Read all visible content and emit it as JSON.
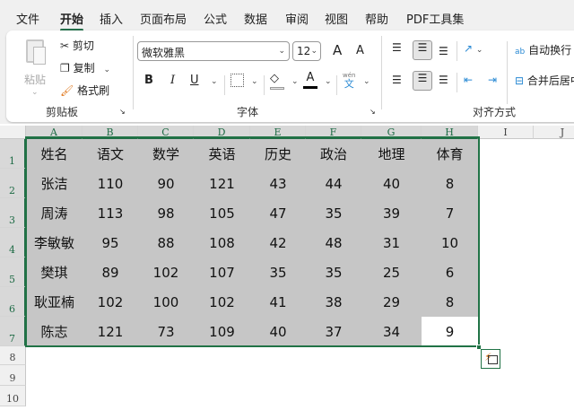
{
  "menu": [
    "文件",
    "开始",
    "插入",
    "页面布局",
    "公式",
    "数据",
    "审阅",
    "视图",
    "帮助",
    "PDF工具集"
  ],
  "menu_active": 1,
  "ribbon": {
    "clipboard": {
      "paste": "粘贴",
      "cut": "剪切",
      "copy": "复制",
      "format_painter": "格式刷",
      "group": "剪贴板"
    },
    "font": {
      "name": "微软雅黑",
      "size": "12",
      "bold": "B",
      "italic": "I",
      "underline": "U",
      "font_color_glyph": "A",
      "phonetic_top": "wén",
      "phonetic_bottom": "文",
      "grow": "A",
      "shrink": "A",
      "group": "字体"
    },
    "alignment": {
      "wrap": "自动换行",
      "merge": "合并后居中",
      "wrap_glyph": "ab",
      "group": "对齐方式"
    }
  },
  "columns": [
    "A",
    "B",
    "C",
    "D",
    "E",
    "F",
    "G",
    "H",
    "I",
    "J"
  ],
  "rows": [
    "1",
    "2",
    "3",
    "4",
    "5",
    "6",
    "7",
    "8",
    "9",
    "10"
  ],
  "table": [
    [
      "姓名",
      "语文",
      "数学",
      "英语",
      "历史",
      "政治",
      "地理",
      "体育"
    ],
    [
      "张洁",
      "110",
      "90",
      "121",
      "43",
      "44",
      "40",
      "8"
    ],
    [
      "周涛",
      "113",
      "98",
      "105",
      "47",
      "35",
      "39",
      "7"
    ],
    [
      "李敏敏",
      "95",
      "88",
      "108",
      "42",
      "48",
      "31",
      "10"
    ],
    [
      "樊琪",
      "89",
      "102",
      "107",
      "35",
      "35",
      "25",
      "6"
    ],
    [
      "耿亚楠",
      "102",
      "100",
      "102",
      "41",
      "38",
      "29",
      "8"
    ],
    [
      "陈志",
      "121",
      "73",
      "109",
      "40",
      "37",
      "34",
      "9"
    ]
  ],
  "active_cell": "H7",
  "colors": {
    "accent": "#217346",
    "selection_fill": "#c6c6c6"
  }
}
